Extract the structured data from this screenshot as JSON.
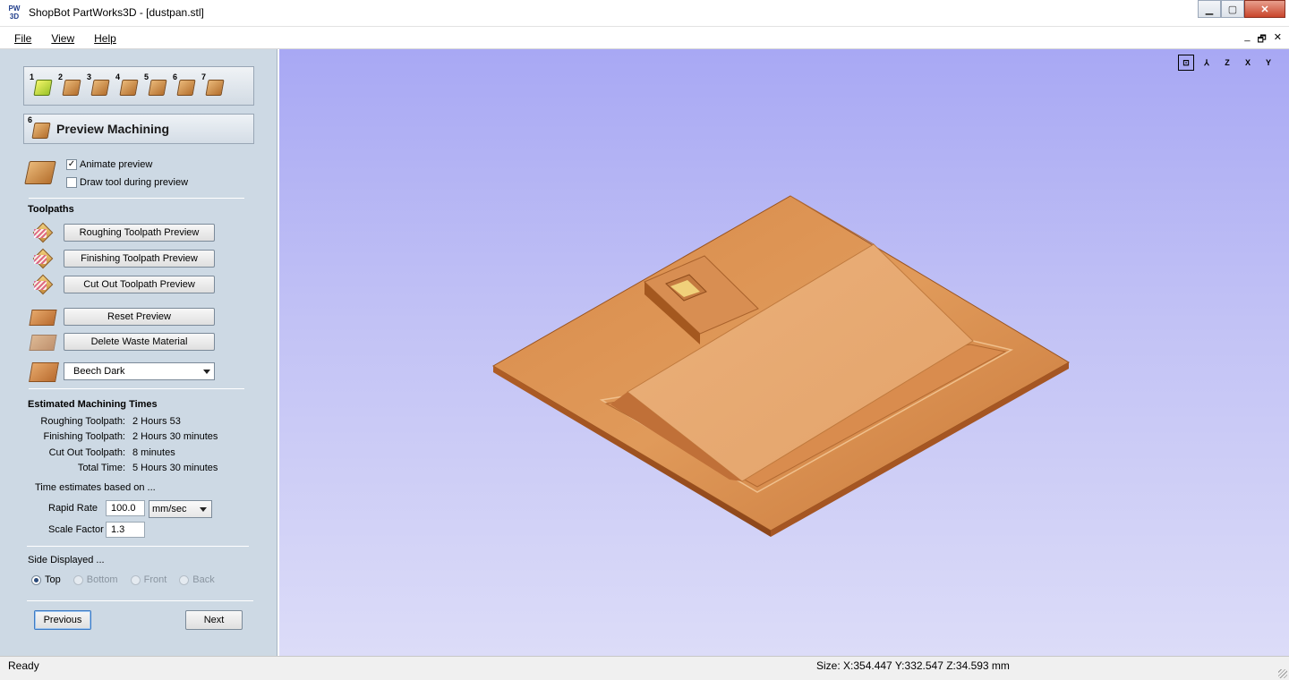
{
  "window": {
    "app_icon_text": "PW 3D",
    "title": "ShopBot PartWorks3D - [dustpan.stl]",
    "minimize": "▁",
    "maximize": "▢",
    "close": "✕"
  },
  "menu": {
    "items": [
      {
        "label": "File"
      },
      {
        "label": "View"
      },
      {
        "label": "Help"
      }
    ],
    "mdi_controls": [
      "_",
      "🗗",
      "✕"
    ]
  },
  "stages": [
    {
      "num": "1",
      "icon": "model-size-icon"
    },
    {
      "num": "2",
      "icon": "position-model-icon"
    },
    {
      "num": "3",
      "icon": "roughing-toolpath-icon"
    },
    {
      "num": "4",
      "icon": "finishing-toolpath-icon"
    },
    {
      "num": "5",
      "icon": "cutout-toolpath-icon"
    },
    {
      "num": "6",
      "icon": "preview-machining-icon"
    },
    {
      "num": "7",
      "icon": "save-toolpaths-icon"
    }
  ],
  "section": {
    "num": "6",
    "title": "Preview Machining"
  },
  "preview_options": {
    "animate_label": "Animate preview",
    "animate_checked": true,
    "draw_tool_label": "Draw tool during preview",
    "draw_tool_checked": false
  },
  "toolpaths": {
    "title": "Toolpaths",
    "roughing_button": "Roughing Toolpath Preview",
    "finishing_button": "Finishing Toolpath Preview",
    "cutout_button": "Cut Out Toolpath Preview",
    "reset_button": "Reset Preview",
    "delete_waste_button": "Delete Waste Material",
    "material_selected": "Beech Dark"
  },
  "times": {
    "title": "Estimated Machining Times",
    "rows": [
      {
        "label": "Roughing Toolpath:",
        "value": "2 Hours 53"
      },
      {
        "label": "Finishing Toolpath:",
        "value": "2 Hours 30 minutes"
      },
      {
        "label": "Cut Out Toolpath:",
        "value": "8 minutes"
      },
      {
        "label": "Total Time:",
        "value": "5 Hours 30 minutes"
      }
    ],
    "note": "Time estimates based on ..."
  },
  "rates": {
    "rapid_label": "Rapid Rate",
    "rapid_value": "100.0",
    "rapid_unit": "mm/sec",
    "scale_label": "Scale Factor",
    "scale_value": "1.3"
  },
  "side": {
    "title": "Side Displayed ...",
    "options": [
      {
        "label": "Top",
        "selected": true,
        "enabled": true
      },
      {
        "label": "Bottom",
        "selected": false,
        "enabled": false
      },
      {
        "label": "Front",
        "selected": false,
        "enabled": false
      },
      {
        "label": "Back",
        "selected": false,
        "enabled": false
      }
    ]
  },
  "nav": {
    "previous": "Previous",
    "next": "Next"
  },
  "view_icons": [
    {
      "name": "zoom-extents-icon",
      "glyph": "⊡"
    },
    {
      "name": "iso-view-icon",
      "glyph": "⅄"
    },
    {
      "name": "view-z-icon",
      "glyph": "Z"
    },
    {
      "name": "view-x-icon",
      "glyph": "X"
    },
    {
      "name": "view-y-icon",
      "glyph": "Y"
    }
  ],
  "status": {
    "left": "Ready",
    "size": "Size: X:354.447 Y:332.547 Z:34.593 mm"
  },
  "colors": {
    "wood_light": "#e2a064",
    "wood_dark": "#b96a2e",
    "viewport_top": "#a8a8f4",
    "viewport_bottom": "#dcdcf8",
    "panel_bg": "#cdd9e4"
  }
}
